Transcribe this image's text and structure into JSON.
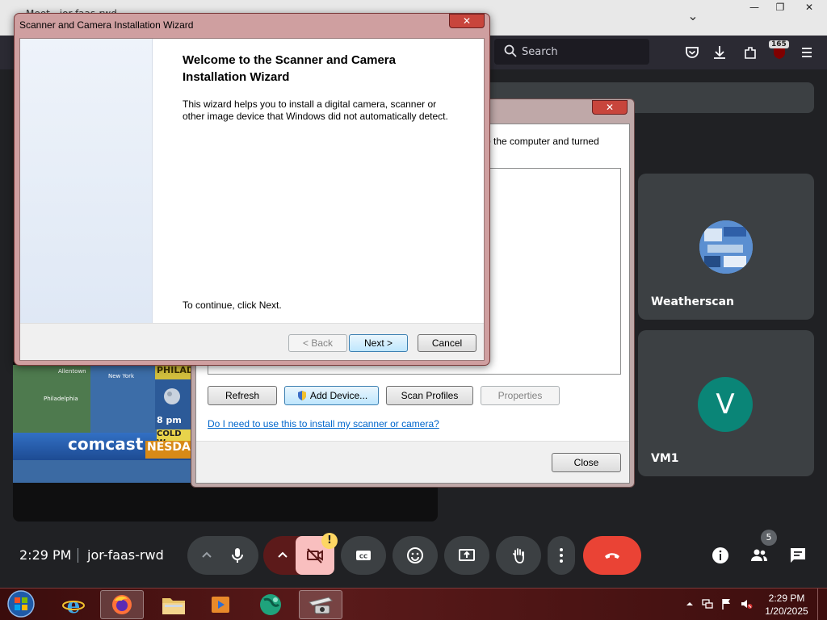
{
  "browser": {
    "tab_title": "Meet - jor-faas-rwd",
    "search_placeholder": "Search",
    "extension_badge": "165"
  },
  "meet": {
    "time": "2:29 PM",
    "meeting_code": "jor-faas-rwd",
    "participants": [
      {
        "name": "Weatherscan"
      },
      {
        "name": "VM1",
        "initial": "V"
      }
    ],
    "people_count": "5",
    "camera_warning": "!",
    "video_feed": {
      "logo": "comcast",
      "city_label": "PHILAD",
      "time_label": "8 pm",
      "headline_1": "COLD W",
      "headline_2": "NESDA",
      "map_labels": [
        "Allentown",
        "New York",
        "Philadelphia"
      ]
    }
  },
  "scanner_dialog": {
    "description_tail": "o the computer and turned",
    "buttons": {
      "refresh": "Refresh",
      "add_device": "Add Device...",
      "scan_profiles": "Scan Profiles",
      "properties": "Properties",
      "close": "Close"
    },
    "help_link": "Do I need to use this to install my scanner or camera?"
  },
  "wizard": {
    "title": "Scanner and Camera Installation Wizard",
    "heading": "Welcome to the Scanner and Camera Installation Wizard",
    "intro": "This wizard helps you to install a digital camera, scanner or other image device that Windows did not automatically detect.",
    "continue_text": "To continue, click Next.",
    "buttons": {
      "back": "< Back",
      "next": "Next >",
      "cancel": "Cancel"
    }
  },
  "taskbar": {
    "clock_time": "2:29 PM",
    "clock_date": "1/20/2025"
  },
  "colors": {
    "meet_bg": "#202124",
    "end_call": "#ea4335",
    "avatar_vm1": "#0a8577",
    "link": "#0066cc"
  }
}
